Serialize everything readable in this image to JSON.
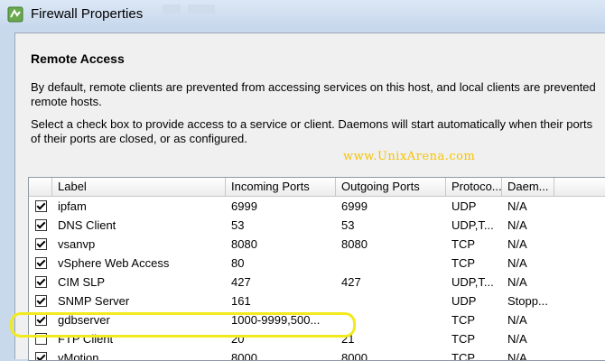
{
  "window": {
    "title": "Firewall Properties"
  },
  "section": {
    "heading": "Remote Access",
    "paragraph1_line1": "By default, remote clients are prevented from accessing services on this host, and local clients are prevented",
    "paragraph1_line2": "remote hosts.",
    "paragraph2_line1": "Select a check box to provide access to a service or client. Daemons will start automatically when their ports",
    "paragraph2_line2": "of their ports are closed, or as configured."
  },
  "watermark": "www.UnixArena.com",
  "table": {
    "columns": [
      "Label",
      "Incoming Ports",
      "Outgoing Ports",
      "Protoco...",
      "Daem..."
    ],
    "rows": [
      {
        "checked": true,
        "label": "ipfam",
        "incoming": "6999",
        "outgoing": "6999",
        "protocol": "UDP",
        "daemon": "N/A"
      },
      {
        "checked": true,
        "label": "DNS Client",
        "incoming": "53",
        "outgoing": "53",
        "protocol": "UDP,T...",
        "daemon": "N/A"
      },
      {
        "checked": true,
        "label": "vsanvp",
        "incoming": "8080",
        "outgoing": "8080",
        "protocol": "TCP",
        "daemon": "N/A"
      },
      {
        "checked": true,
        "label": "vSphere Web Access",
        "incoming": "80",
        "outgoing": "",
        "protocol": "TCP",
        "daemon": "N/A"
      },
      {
        "checked": true,
        "label": "CIM SLP",
        "incoming": "427",
        "outgoing": "427",
        "protocol": "UDP,T...",
        "daemon": "N/A"
      },
      {
        "checked": true,
        "label": "SNMP Server",
        "incoming": "161",
        "outgoing": "",
        "protocol": "UDP",
        "daemon": "Stopp..."
      },
      {
        "checked": true,
        "label": "gdbserver",
        "incoming": "1000-9999,500...",
        "outgoing": "",
        "protocol": "TCP",
        "daemon": "N/A"
      },
      {
        "checked": false,
        "label": "FTP Client",
        "incoming": "20",
        "outgoing": "21",
        "protocol": "TCP",
        "daemon": "N/A"
      },
      {
        "checked": true,
        "label": "vMotion",
        "incoming": "8000",
        "outgoing": "8000",
        "protocol": "TCP",
        "daemon": "N/A"
      }
    ]
  }
}
